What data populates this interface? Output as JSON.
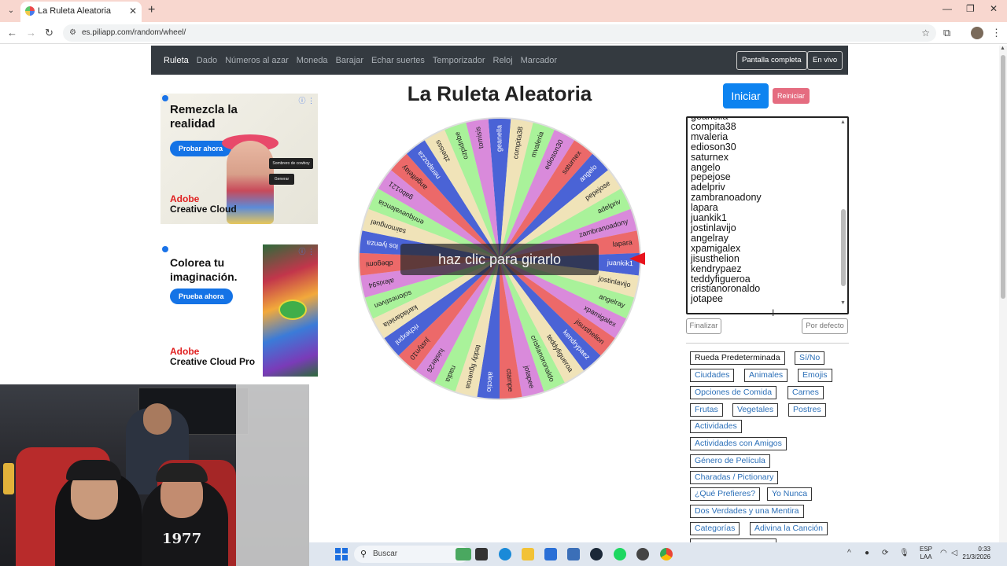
{
  "browser": {
    "tab_title": "La Ruleta Aleatoria",
    "url": "es.piliapp.com/random/wheel/"
  },
  "sitenav": {
    "items": [
      "Ruleta",
      "Dado",
      "Números al azar",
      "Moneda",
      "Barajar",
      "Echar suertes",
      "Temporizador",
      "Reloj",
      "Marcador"
    ],
    "fullscreen_label": "Pantalla completa",
    "live_label": "En vivo"
  },
  "ads": {
    "ad1": {
      "headline1": "Remezcla la",
      "headline2": "realidad",
      "cta": "Probar ahora",
      "brand1": "Adobe",
      "brand2": "Creative Cloud",
      "chip1": "Sombrero de cowboy rosa",
      "chip2": "Generar"
    },
    "ad2": {
      "headline1": "Colorea tu",
      "headline2": "imaginación.",
      "cta": "Prueba ahora",
      "brand1": "Adobe",
      "brand2": "Creative Cloud Pro"
    }
  },
  "webcam": {
    "shirt_text": "1977"
  },
  "page": {
    "title": "La Ruleta Aleatoria",
    "spin_hint": "haz clic para girarlo",
    "start_label": "Iniciar",
    "reset_label": "Reiniciar",
    "finish_label": "Finalizar",
    "default_label": "Por defecto"
  },
  "wheel": {
    "segments": [
      "geanella",
      "compita38",
      "mvaleria",
      "edioson30",
      "saturnex",
      "angelo",
      "pepejose",
      "adelpriv",
      "zambranoadony",
      "lapara",
      "juankik1",
      "jostinlavijo",
      "angelray",
      "xpamigalex",
      "jisusthelion",
      "kendrypaez",
      "teddyfigueroa",
      "cristianoronaldo",
      "jotapee",
      "ctampe",
      "alectio",
      "teddy figueroa",
      "nadia",
      "luisfer26",
      "justyn10",
      "richexpnl",
      "karladaniela",
      "solonestiven",
      "alexis94",
      "dbegomi",
      "los lyenza",
      "saimonguel",
      "enriquevalencia",
      "gabo121",
      "angelfelay",
      "nerapozza",
      "zbeisss",
      "ozpidnbe",
      "tomisis"
    ],
    "colors": [
      "#4a63d6",
      "#f0e3b8",
      "#a9f29a",
      "#d98adb",
      "#ec6969"
    ]
  },
  "namelist": {
    "names": [
      "geanella",
      "compita38",
      "mvaleria",
      "edioson30",
      "saturnex",
      "angelo",
      "pepejose",
      "adelpriv",
      "zambranoadony",
      "lapara",
      "juankik1",
      "jostinlavijo",
      "angelray",
      "xpamigalex",
      "jisusthelion",
      "kendrypaez",
      "teddyfigueroa",
      "cristianoronaldo",
      "jotapee"
    ]
  },
  "presets": {
    "rows": [
      [
        "Rueda Predeterminada",
        "Sí/No"
      ],
      [
        "Ciudades",
        "Animales",
        "Emojis"
      ],
      [
        "Opciones de Comida",
        "Carnes"
      ],
      [
        "Frutas",
        "Vegetales",
        "Postres"
      ],
      [
        "Actividades"
      ],
      [
        "Actividades con Amigos"
      ],
      [
        "Género de Película"
      ],
      [
        "Charadas / Pictionary"
      ],
      [
        "¿Qué Prefieres?",
        "Yo Nunca"
      ],
      [
        "Dos Verdades y una Mentira"
      ],
      [
        "Categorías",
        "Adivina la Canción"
      ]
    ]
  },
  "taskbar": {
    "search_placeholder": "Buscar",
    "lang1": "ESP",
    "lang2": "LAA",
    "time": "0:33",
    "date": "21/3/2026"
  }
}
